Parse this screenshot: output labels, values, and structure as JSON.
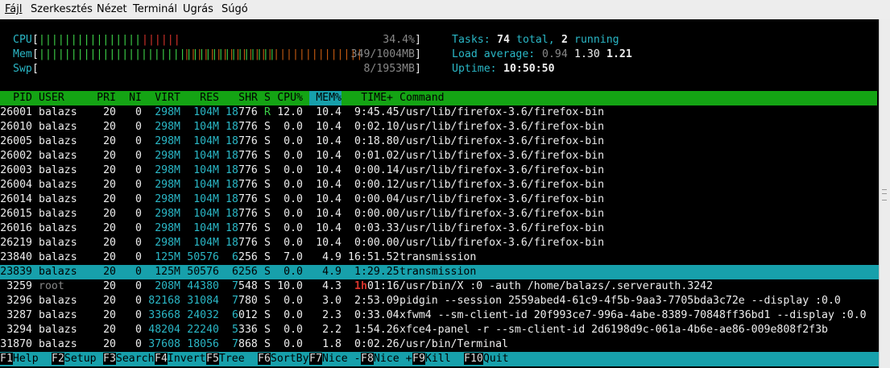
{
  "menubar": {
    "items": [
      {
        "label": "Fájl"
      },
      {
        "label": "Szerkesztés"
      },
      {
        "label": "Nézet"
      },
      {
        "label": "Terminál"
      },
      {
        "label": "Ugrás"
      },
      {
        "label": "Súgó"
      }
    ]
  },
  "meters": {
    "cpu_label": "CPU",
    "cpu_bar_low": "||||||||||||||||",
    "cpu_bar_high": "||||||",
    "cpu_value": "34.4%",
    "mem_label": "Mem",
    "mem_bar_low": "|||||||||||||||||||||||||||||||||||||",
    "mem_bar_cache": "||||||||||||||||||||||||||||",
    "mem_value": "349/1004MB",
    "swp_label": "Swp",
    "swp_value": "8/1953MB"
  },
  "summary": {
    "tasks_label": "Tasks:",
    "tasks_total": "74",
    "tasks_total_suffix": "total,",
    "tasks_running": "2",
    "tasks_running_suffix": "running",
    "load_label": "Load average:",
    "load_1": "0.94",
    "load_5": "1.30",
    "load_15": "1.21",
    "uptime_label": "Uptime:",
    "uptime_value": "10:50:50"
  },
  "table": {
    "headers": [
      "PID",
      "USER",
      "PRI",
      "NI",
      "VIRT",
      "RES",
      "SHR",
      "S",
      "CPU%",
      "MEM%",
      "TIME+",
      "Command"
    ],
    "sort_column": "MEM%",
    "selected_row": 11,
    "rows": [
      {
        "pid": "26001",
        "user": "balazs",
        "pri": "20",
        "ni": "0",
        "virt": "298M",
        "res": "104M",
        "shr_hi": "18",
        "shr_lo": "776",
        "s": "R",
        "cpu": "12.0",
        "mem": "10.4",
        "time_hi": "",
        "time_lo": "9:45.45",
        "cmd": "/usr/lib/firefox-3.6/firefox-bin"
      },
      {
        "pid": "26010",
        "user": "balazs",
        "pri": "20",
        "ni": "0",
        "virt": "298M",
        "res": "104M",
        "shr_hi": "18",
        "shr_lo": "776",
        "s": "S",
        "cpu": "0.0",
        "mem": "10.4",
        "time_hi": "",
        "time_lo": "0:02.10",
        "cmd": "/usr/lib/firefox-3.6/firefox-bin"
      },
      {
        "pid": "26005",
        "user": "balazs",
        "pri": "20",
        "ni": "0",
        "virt": "298M",
        "res": "104M",
        "shr_hi": "18",
        "shr_lo": "776",
        "s": "S",
        "cpu": "0.0",
        "mem": "10.4",
        "time_hi": "",
        "time_lo": "0:18.80",
        "cmd": "/usr/lib/firefox-3.6/firefox-bin"
      },
      {
        "pid": "26002",
        "user": "balazs",
        "pri": "20",
        "ni": "0",
        "virt": "298M",
        "res": "104M",
        "shr_hi": "18",
        "shr_lo": "776",
        "s": "S",
        "cpu": "0.0",
        "mem": "10.4",
        "time_hi": "",
        "time_lo": "0:01.02",
        "cmd": "/usr/lib/firefox-3.6/firefox-bin"
      },
      {
        "pid": "26003",
        "user": "balazs",
        "pri": "20",
        "ni": "0",
        "virt": "298M",
        "res": "104M",
        "shr_hi": "18",
        "shr_lo": "776",
        "s": "S",
        "cpu": "0.0",
        "mem": "10.4",
        "time_hi": "",
        "time_lo": "0:00.14",
        "cmd": "/usr/lib/firefox-3.6/firefox-bin"
      },
      {
        "pid": "26004",
        "user": "balazs",
        "pri": "20",
        "ni": "0",
        "virt": "298M",
        "res": "104M",
        "shr_hi": "18",
        "shr_lo": "776",
        "s": "S",
        "cpu": "0.0",
        "mem": "10.4",
        "time_hi": "",
        "time_lo": "0:00.12",
        "cmd": "/usr/lib/firefox-3.6/firefox-bin"
      },
      {
        "pid": "26014",
        "user": "balazs",
        "pri": "20",
        "ni": "0",
        "virt": "298M",
        "res": "104M",
        "shr_hi": "18",
        "shr_lo": "776",
        "s": "S",
        "cpu": "0.0",
        "mem": "10.4",
        "time_hi": "",
        "time_lo": "0:00.04",
        "cmd": "/usr/lib/firefox-3.6/firefox-bin"
      },
      {
        "pid": "26015",
        "user": "balazs",
        "pri": "20",
        "ni": "0",
        "virt": "298M",
        "res": "104M",
        "shr_hi": "18",
        "shr_lo": "776",
        "s": "S",
        "cpu": "0.0",
        "mem": "10.4",
        "time_hi": "",
        "time_lo": "0:00.00",
        "cmd": "/usr/lib/firefox-3.6/firefox-bin"
      },
      {
        "pid": "26016",
        "user": "balazs",
        "pri": "20",
        "ni": "0",
        "virt": "298M",
        "res": "104M",
        "shr_hi": "18",
        "shr_lo": "776",
        "s": "S",
        "cpu": "0.0",
        "mem": "10.4",
        "time_hi": "",
        "time_lo": "0:03.33",
        "cmd": "/usr/lib/firefox-3.6/firefox-bin"
      },
      {
        "pid": "26219",
        "user": "balazs",
        "pri": "20",
        "ni": "0",
        "virt": "298M",
        "res": "104M",
        "shr_hi": "18",
        "shr_lo": "776",
        "s": "S",
        "cpu": "0.0",
        "mem": "10.4",
        "time_hi": "",
        "time_lo": "0:00.00",
        "cmd": "/usr/lib/firefox-3.6/firefox-bin"
      },
      {
        "pid": "23840",
        "user": "balazs",
        "pri": "20",
        "ni": "0",
        "virt": "125M",
        "res": "50576",
        "shr_hi": "6",
        "shr_lo": "256",
        "s": "S",
        "cpu": "7.0",
        "mem": "4.9",
        "time_hi": "",
        "time_lo": "16:51.52",
        "cmd": "transmission"
      },
      {
        "pid": "23839",
        "user": "balazs",
        "pri": "20",
        "ni": "0",
        "virt": "125M",
        "res": "50576",
        "shr_hi": "6",
        "shr_lo": "256",
        "s": "S",
        "cpu": "0.0",
        "mem": "4.9",
        "time_hi": "",
        "time_lo": "1:29.25",
        "cmd": "transmission"
      },
      {
        "pid": "3259",
        "user": "root",
        "pri": "20",
        "ni": "0",
        "virt": "208M",
        "res": "44380",
        "shr_hi": "7",
        "shr_lo": "548",
        "s": "S",
        "cpu": "10.0",
        "mem": "4.3",
        "time_hi": "1h",
        "time_lo": "01:16",
        "cmd": "/usr/bin/X :0 -auth /home/balazs/.serverauth.3242"
      },
      {
        "pid": "3296",
        "user": "balazs",
        "pri": "20",
        "ni": "0",
        "virt": "82168",
        "res": "31084",
        "shr_hi": "7",
        "shr_lo": "780",
        "s": "S",
        "cpu": "0.0",
        "mem": "3.0",
        "time_hi": "",
        "time_lo": "2:53.09",
        "cmd": "pidgin --session 2559abed4-61c9-4f5b-9aa3-7705bda3c72e --display :0.0"
      },
      {
        "pid": "3287",
        "user": "balazs",
        "pri": "20",
        "ni": "0",
        "virt": "33668",
        "res": "24032",
        "shr_hi": "6",
        "shr_lo": "012",
        "s": "S",
        "cpu": "0.0",
        "mem": "2.3",
        "time_hi": "",
        "time_lo": "0:33.04",
        "cmd": "xfwm4 --sm-client-id 20f993ce7-996a-4abe-8389-70848ff36bd1 --display :0.0"
      },
      {
        "pid": "3294",
        "user": "balazs",
        "pri": "20",
        "ni": "0",
        "virt": "48204",
        "res": "22240",
        "shr_hi": "5",
        "shr_lo": "336",
        "s": "S",
        "cpu": "0.0",
        "mem": "2.2",
        "time_hi": "",
        "time_lo": "1:54.26",
        "cmd": "xfce4-panel -r --sm-client-id 2d6198d9c-061a-4b6e-ae86-009e808f2f3b"
      },
      {
        "pid": "31870",
        "user": "balazs",
        "pri": "20",
        "ni": "0",
        "virt": "37608",
        "res": "18056",
        "shr_hi": "7",
        "shr_lo": "868",
        "s": "S",
        "cpu": "0.0",
        "mem": "1.8",
        "time_hi": "",
        "time_lo": "0:02.26",
        "cmd": "/usr/bin/Terminal"
      }
    ]
  },
  "footer": {
    "keys": [
      {
        "key": "F1",
        "label": "Help  "
      },
      {
        "key": "F2",
        "label": "Setup "
      },
      {
        "key": "F3",
        "label": "Search"
      },
      {
        "key": "F4",
        "label": "Invert"
      },
      {
        "key": "F5",
        "label": "Tree  "
      },
      {
        "key": "F6",
        "label": "SortBy"
      },
      {
        "key": "F7",
        "label": "Nice -"
      },
      {
        "key": "F8",
        "label": "Nice +"
      },
      {
        "key": "F9",
        "label": "Kill  "
      },
      {
        "key": "F10",
        "label": "Quit"
      }
    ]
  },
  "colors": {
    "header_bg": "#14a414",
    "selection_bg": "#17a0ab",
    "accent_cyan": "#2ab7c6",
    "cpu_low": "#3cd048",
    "cpu_high": "#d6332b",
    "mem_cache": "#c55a11"
  }
}
